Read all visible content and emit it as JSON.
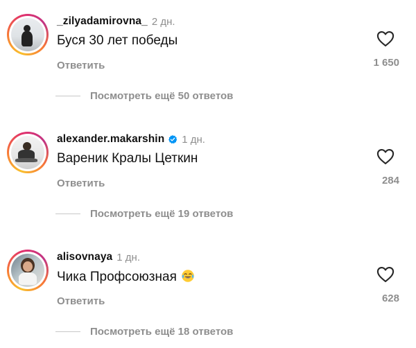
{
  "comments": [
    {
      "username": "_zilyadamirovna_",
      "verified": false,
      "time": "2 дн.",
      "text": "Буся 30 лет победы",
      "emoji": "",
      "reply_label": "Ответить",
      "likes": "1 650",
      "view_more": "Посмотреть ещё 50 ответов"
    },
    {
      "username": "alexander.makarshin",
      "verified": true,
      "time": "1 дн.",
      "text": "Вареник Кралы Цеткин",
      "emoji": "",
      "reply_label": "Ответить",
      "likes": "284",
      "view_more": "Посмотреть ещё 19 ответов"
    },
    {
      "username": "alisovnaya",
      "verified": false,
      "time": "1 дн.",
      "text": "Чика Профсоюзная",
      "emoji": "😂",
      "reply_label": "Ответить",
      "likes": "628",
      "view_more": "Посмотреть ещё 18 ответов"
    }
  ],
  "icons": {
    "like": "heart-outline-icon",
    "verified": "verified-badge-icon",
    "emoji": "face-with-tears-of-joy"
  },
  "colors": {
    "verified_blue": "#0095f6",
    "secondary_text": "#8e8e8e",
    "primary_text": "#111111"
  }
}
